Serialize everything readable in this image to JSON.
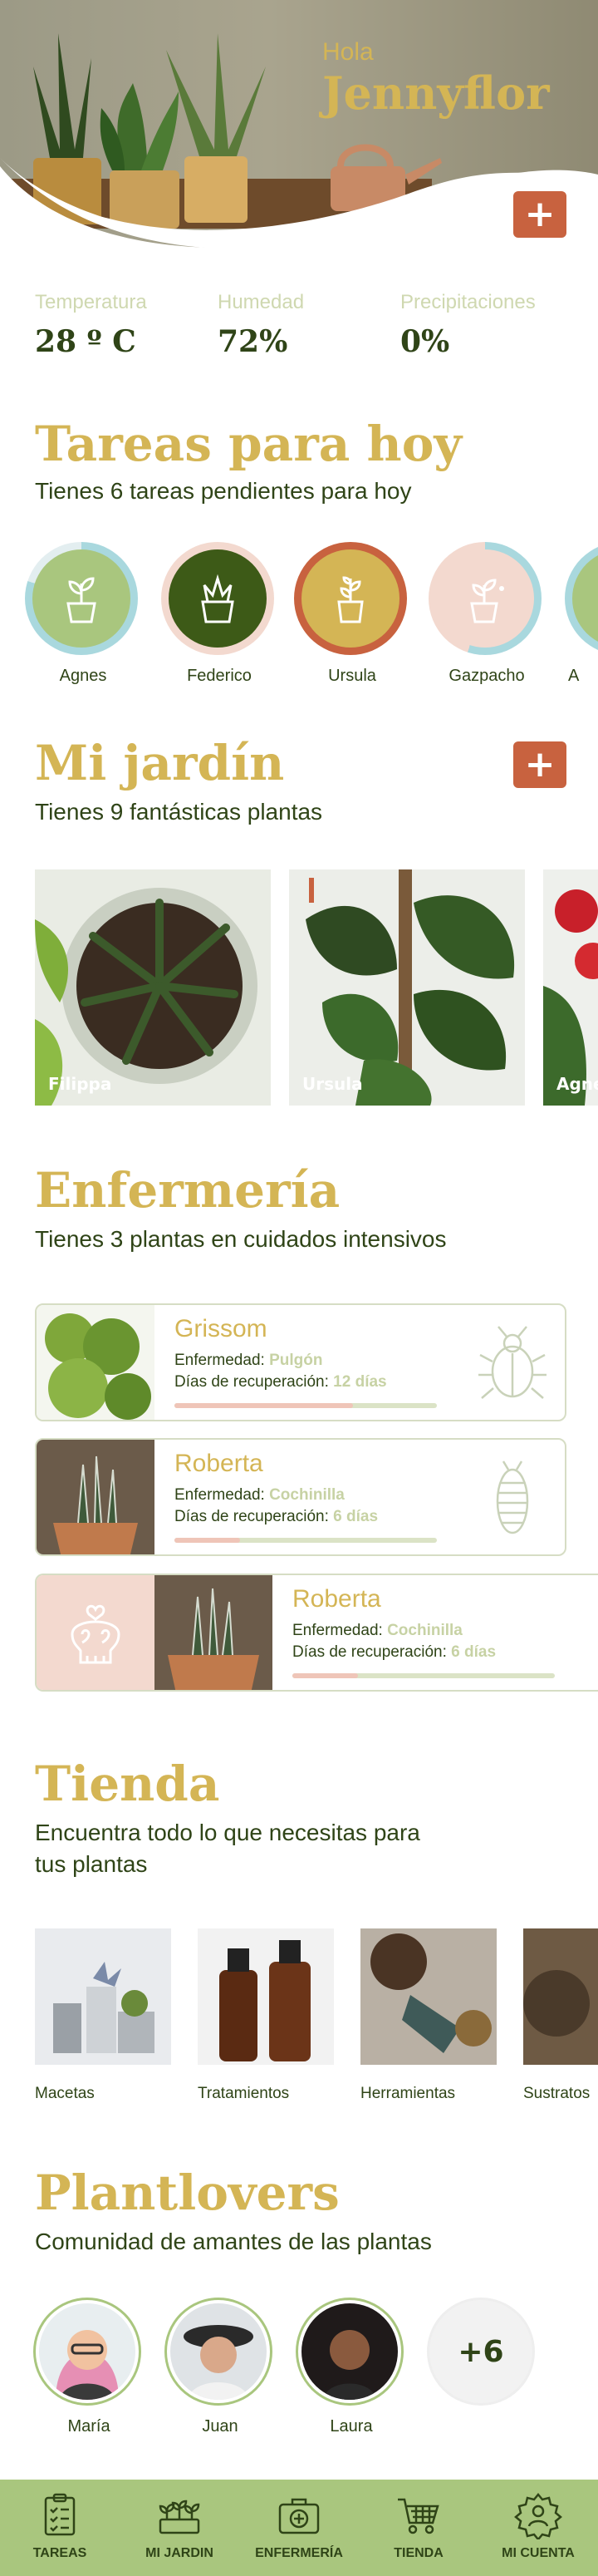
{
  "header": {
    "greeting": "Hola",
    "user_name": "Jennyflor",
    "add_icon": "plus-icon"
  },
  "weather": [
    {
      "label": "Temperatura",
      "value": "28 º C"
    },
    {
      "label": "Humedad",
      "value": "72%"
    },
    {
      "label": "Precipitaciones",
      "value": "0%"
    }
  ],
  "tasks": {
    "title": "Tareas para hoy",
    "subtitle": "Tienes 6 tareas pendientes para hoy",
    "items": [
      {
        "name": "Agnes",
        "icon": "plant-watering-icon",
        "ring_color": "#a9d8de",
        "fill_color": "#a9c67e"
      },
      {
        "name": "Federico",
        "icon": "succulent-icon",
        "ring_color": "#f3d9cf",
        "fill_color": "#3d5a17"
      },
      {
        "name": "Ursula",
        "icon": "plant-fertilize-icon",
        "ring_color": "#c8623f",
        "fill_color": "#d4b555"
      },
      {
        "name": "Gazpacho",
        "icon": "plant-spray-icon",
        "ring_color": "#a9d8de",
        "fill_color": "#f3d9cf"
      },
      {
        "name": "A",
        "icon": "plant-icon",
        "ring_color": "#a9d8de",
        "fill_color": "#a9c67e"
      }
    ]
  },
  "garden": {
    "title": "Mi jardín",
    "subtitle": "Tienes 9 fantásticas plantas",
    "plants": [
      {
        "name": "Filippa"
      },
      {
        "name": "Ursula"
      },
      {
        "name": "Agne"
      }
    ]
  },
  "infirmary": {
    "title": "Enfermería",
    "subtitle": "Tienes 3 plantas en cuidados intensivos",
    "disease_label": "Enfermedad:",
    "recovery_label": "Días de recuperación:",
    "cards": [
      {
        "name": "Grissom",
        "disease": "Pulgón",
        "days": "12 días",
        "progress": 0.68,
        "icon": "aphid-bug-icon"
      },
      {
        "name": "Roberta",
        "disease": "Cochinilla",
        "days": "6 días",
        "progress": 0.25,
        "icon": "mealybug-icon"
      },
      {
        "name": "Roberta",
        "disease": "Cochinilla",
        "days": "6 días",
        "progress": 0.25,
        "icon": "skull-heart-icon"
      }
    ]
  },
  "shop": {
    "title": "Tienda",
    "subtitle_line1": "Encuentra todo lo que necesitas para",
    "subtitle_line2": "tus plantas",
    "categories": [
      {
        "name": "Macetas"
      },
      {
        "name": "Tratamientos"
      },
      {
        "name": "Herramientas"
      },
      {
        "name": "Sustratos"
      }
    ]
  },
  "community": {
    "title": "Plantlovers",
    "subtitle": "Comunidad de amantes de las plantas",
    "members": [
      {
        "name": "María"
      },
      {
        "name": "Juan"
      },
      {
        "name": "Laura"
      }
    ],
    "more_count": "+6"
  },
  "nav": [
    {
      "label": "TAREAS",
      "icon": "clipboard-checklist-icon"
    },
    {
      "label": "MI JARDIN",
      "icon": "garden-planter-icon"
    },
    {
      "label": "ENFERMERÍA",
      "icon": "first-aid-kit-icon"
    },
    {
      "label": "TIENDA",
      "icon": "shopping-cart-icon"
    },
    {
      "label": "MI CUENTA",
      "icon": "user-gear-icon"
    }
  ],
  "colors": {
    "dark_green": "#2f4417",
    "gold": "#d4b555",
    "terracotta": "#c8623f",
    "light_green": "#a9c67e",
    "pale_green": "#cfd8b0"
  }
}
